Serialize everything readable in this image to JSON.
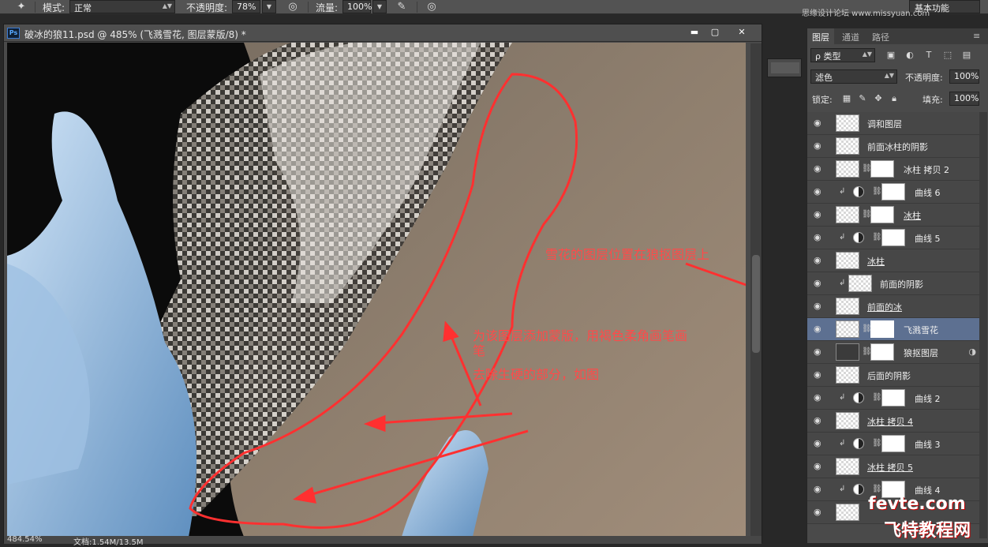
{
  "options_bar": {
    "mode_label": "模式:",
    "mode_value": "正常",
    "opacity_label": "不透明度:",
    "opacity_value": "78%",
    "flow_label": "流量:",
    "flow_value": "100%",
    "workspace": "基本功能",
    "site_watermark": "思缘设计论坛 www.missyuan.com"
  },
  "document": {
    "title": "破冰的狼11.psd @ 485% (飞溅雪花, 图层蒙版/8) *",
    "zoom": "484.54%",
    "doc_size": "文档:1.54M/13.5M",
    "annotation_top": "雪花的图层位置在狼抠图层上",
    "annotation_lines": [
      "为该图层添加蒙版，用褐色柔角画笔画",
      "笔",
      "去除生硬的部分，如图"
    ]
  },
  "panel": {
    "tabs": [
      "图层",
      "通道",
      "路径"
    ],
    "filter_label": "ρ 类型",
    "blend_mode": "滤色",
    "opacity_label": "不透明度:",
    "opacity_value": "100%",
    "lock_label": "锁定:",
    "fill_label": "填充:",
    "fill_value": "100%"
  },
  "layers": [
    {
      "name": "调和图层"
    },
    {
      "name": "前面冰柱的阴影"
    },
    {
      "name": "冰柱 拷贝 2"
    },
    {
      "name": "曲线 6"
    },
    {
      "name": "冰柱"
    },
    {
      "name": "曲线 5"
    },
    {
      "name": "冰柱"
    },
    {
      "name": "前面的阴影"
    },
    {
      "name": "前面的冰"
    },
    {
      "name": "飞溅雪花"
    },
    {
      "name": "狼抠图层"
    },
    {
      "name": "后面的阴影"
    },
    {
      "name": "曲线 2"
    },
    {
      "name": "冰柱 拷贝 4"
    },
    {
      "name": "曲线 3"
    },
    {
      "name": "冰柱 拷贝 5"
    },
    {
      "name": "曲线 4"
    }
  ],
  "watermark": {
    "line1": "fevte.com",
    "line2": "飞特教程网"
  }
}
